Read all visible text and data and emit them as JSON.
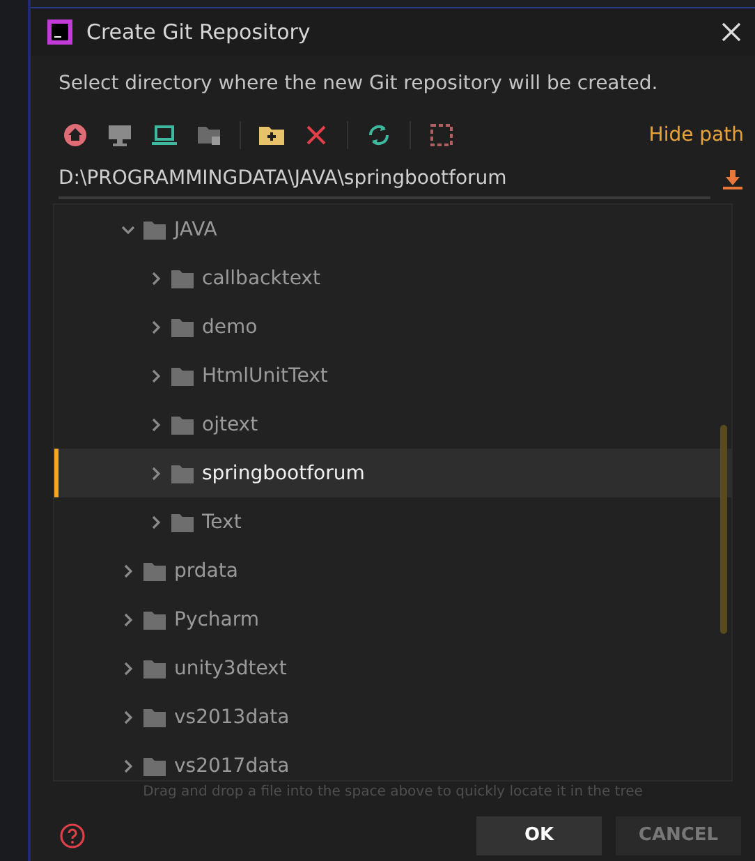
{
  "window": {
    "title": "Create Git Repository"
  },
  "description": "Select directory where the new Git repository will be created.",
  "toolbar": {
    "hide_path": "Hide path"
  },
  "path_field": {
    "value": "D:\\PROGRAMMINGDATA\\JAVA\\springbootforum"
  },
  "tree": [
    {
      "label": "JAVA",
      "expanded": true,
      "selected": false,
      "children": [
        {
          "label": "callbacktext",
          "expanded": false,
          "selected": false
        },
        {
          "label": "demo",
          "expanded": false,
          "selected": false
        },
        {
          "label": "HtmlUnitText",
          "expanded": false,
          "selected": false
        },
        {
          "label": "ojtext",
          "expanded": false,
          "selected": false
        },
        {
          "label": "springbootforum",
          "expanded": false,
          "selected": true
        },
        {
          "label": "Text",
          "expanded": false,
          "selected": false
        }
      ]
    },
    {
      "label": "prdata",
      "expanded": false,
      "selected": false
    },
    {
      "label": "Pycharm",
      "expanded": false,
      "selected": false
    },
    {
      "label": "unity3dtext",
      "expanded": false,
      "selected": false
    },
    {
      "label": "vs2013data",
      "expanded": false,
      "selected": false
    },
    {
      "label": "vs2017data",
      "expanded": false,
      "selected": false
    }
  ],
  "hint": "Drag and drop a file into the space above to quickly locate it in the tree",
  "buttons": [
    {
      "label": "OK",
      "kind": "primary"
    },
    {
      "label": "CANCEL",
      "kind": "secondary"
    }
  ]
}
